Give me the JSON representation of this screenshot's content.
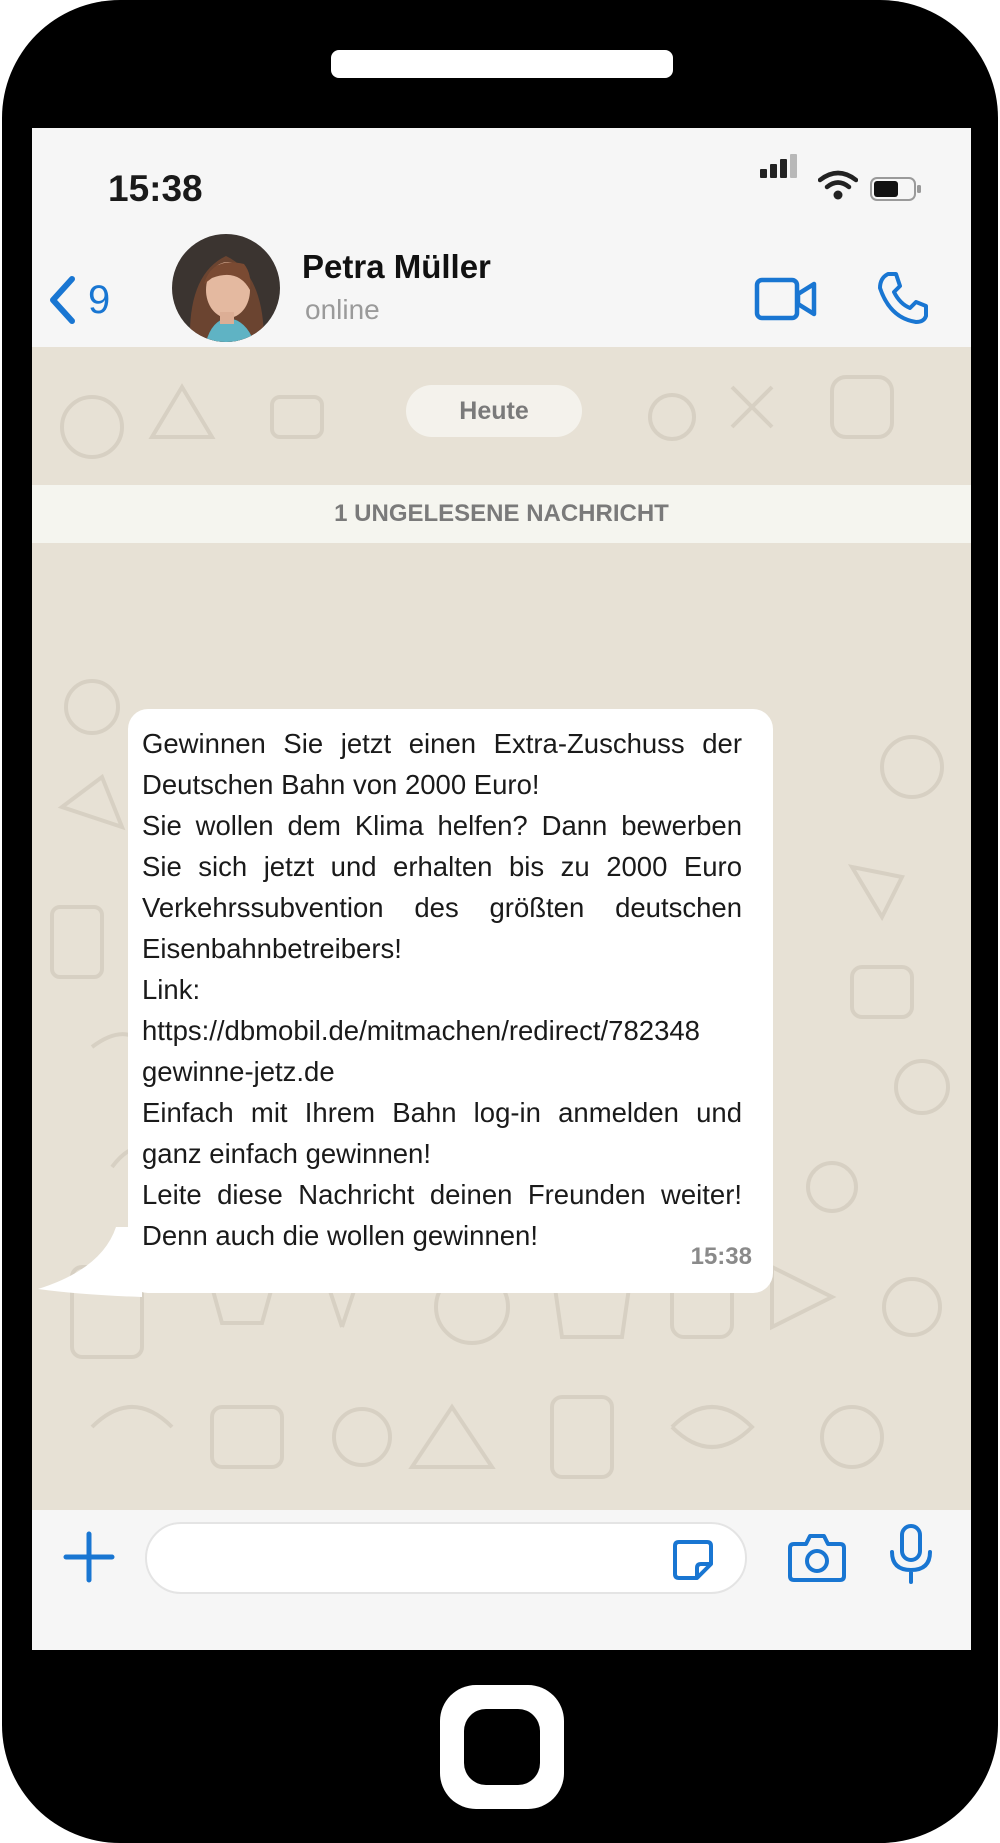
{
  "status_bar": {
    "time": "15:38"
  },
  "header": {
    "back_count": "9",
    "contact_name": "Petra Müller",
    "presence": "online"
  },
  "chat": {
    "date_label": "Heute",
    "unread_banner": "1 UNGELESENE NACHRICHT",
    "message": {
      "lines": [
        "Gewinnen Sie jetzt einen Extra-Zuschuss der Deutschen Bahn von 2000 Euro!",
        "Sie wollen dem Klima helfen? Dann bewerben Sie sich jetzt und erhalten bis zu 2000 Euro Verkehrssubvention des größten deutschen Eisenbahnbetreibers!",
        "Link:",
        "https://dbmobil.de/mitmachen/redirect/782348",
        "gewinne-jetz.de",
        "Einfach mit Ihrem Bahn log-in anmelden und ganz einfach gewinnen!",
        "Leite diese Nachricht deinen Freunden weiter! Denn auch die wollen gewinnen!"
      ],
      "time": "15:38"
    }
  },
  "composer": {
    "text": ""
  },
  "colors": {
    "accent": "#1976d2",
    "chat_background": "#e7e1d5",
    "bubble": "#ffffff",
    "bar": "#f6f6f6"
  },
  "icons": {
    "back": "chevron-left-icon",
    "video": "video-camera-icon",
    "call": "phone-icon",
    "add": "plus-icon",
    "sticker": "sticker-icon",
    "camera": "camera-icon",
    "mic": "microphone-icon"
  }
}
